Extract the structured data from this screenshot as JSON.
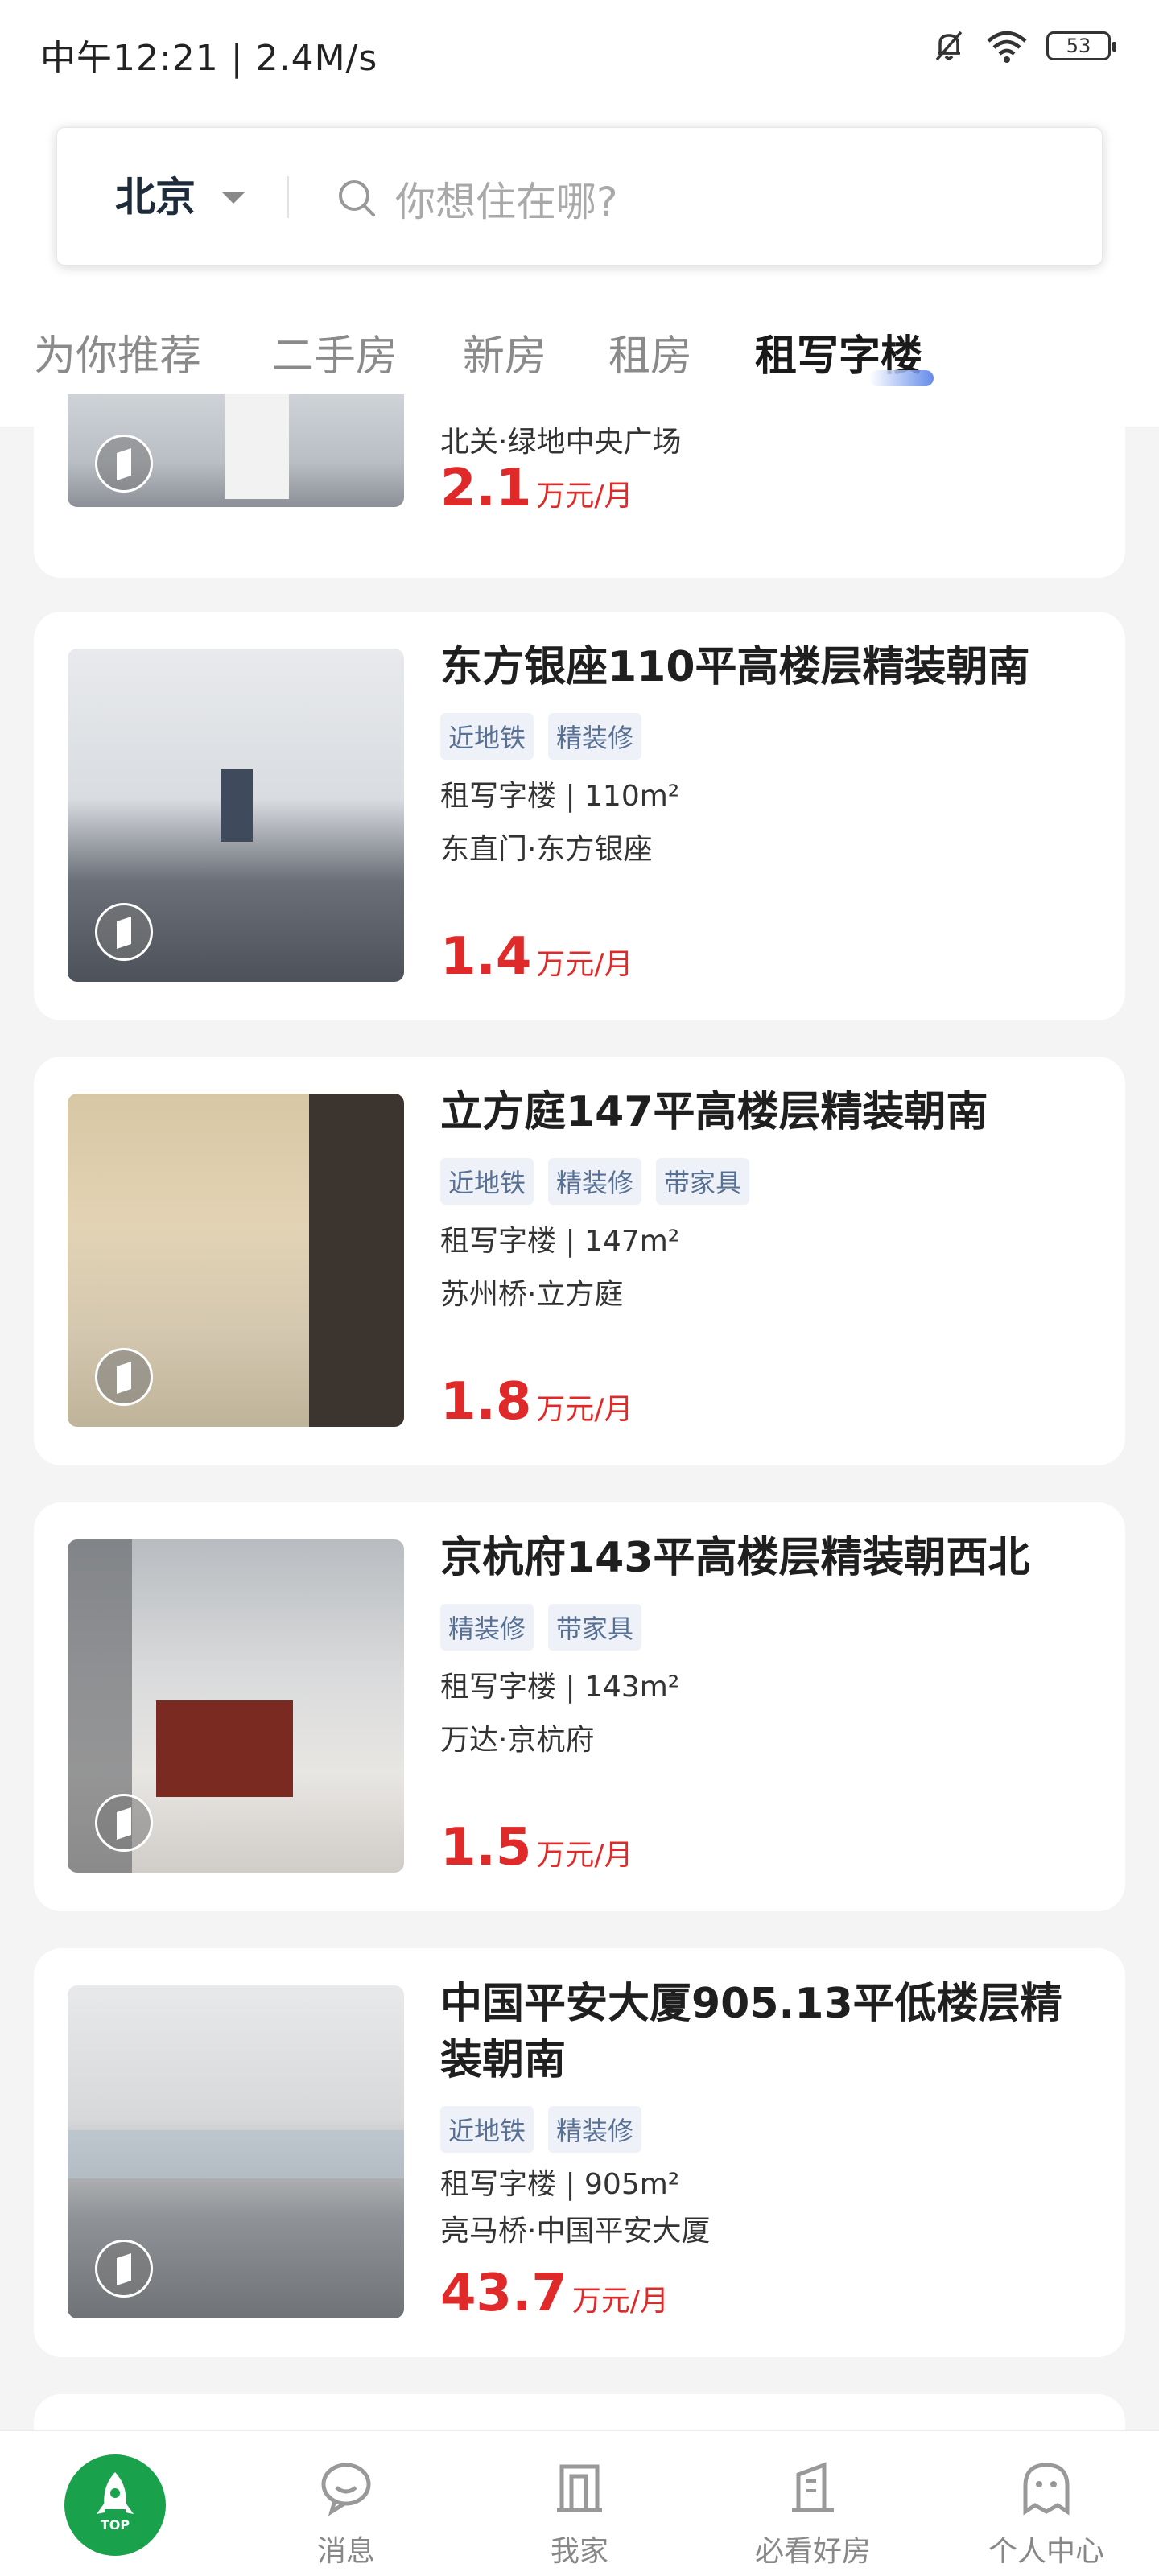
{
  "status_bar": {
    "time": "中午12:21 | 2.4M/s",
    "battery": "53"
  },
  "search": {
    "city": "北京",
    "placeholder": "你想住在哪?"
  },
  "tabs": [
    {
      "label": "为你推荐"
    },
    {
      "label": "二手房"
    },
    {
      "label": "新房"
    },
    {
      "label": "租房"
    },
    {
      "label": "租写字楼",
      "active": true
    }
  ],
  "listings": [
    {
      "location": "北关·绿地中央广场",
      "price": "2.1",
      "unit": "万元/月"
    },
    {
      "title": "东方银座110平高楼层精装朝南",
      "tags": [
        "近地铁",
        "精装修"
      ],
      "meta": "租写字楼 | 110m²",
      "location": "东直门·东方银座",
      "price": "1.4",
      "unit": "万元/月"
    },
    {
      "title": "立方庭147平高楼层精装朝南",
      "tags": [
        "近地铁",
        "精装修",
        "带家具"
      ],
      "meta": "租写字楼 | 147m²",
      "location": "苏州桥·立方庭",
      "price": "1.8",
      "unit": "万元/月"
    },
    {
      "title": "京杭府143平高楼层精装朝西北",
      "tags": [
        "精装修",
        "带家具"
      ],
      "meta": "租写字楼 | 143m²",
      "location": "万达·京杭府",
      "price": "1.5",
      "unit": "万元/月"
    },
    {
      "title": "中国平安大厦905.13平低楼层精装朝南",
      "tags": [
        "近地铁",
        "精装修"
      ],
      "meta": "租写字楼 | 905m²",
      "location": "亮马桥·中国平安大厦",
      "price": "43.7",
      "unit": "万元/月"
    }
  ],
  "bottom_nav": {
    "top_label": "TOP",
    "items": [
      {
        "label": "消息"
      },
      {
        "label": "我家"
      },
      {
        "label": "必看好房"
      },
      {
        "label": "个人中心"
      }
    ]
  },
  "colors": {
    "accent_green": "#1aa14c",
    "price_red": "#e02a2a",
    "tag_bg": "#eef2f8"
  }
}
